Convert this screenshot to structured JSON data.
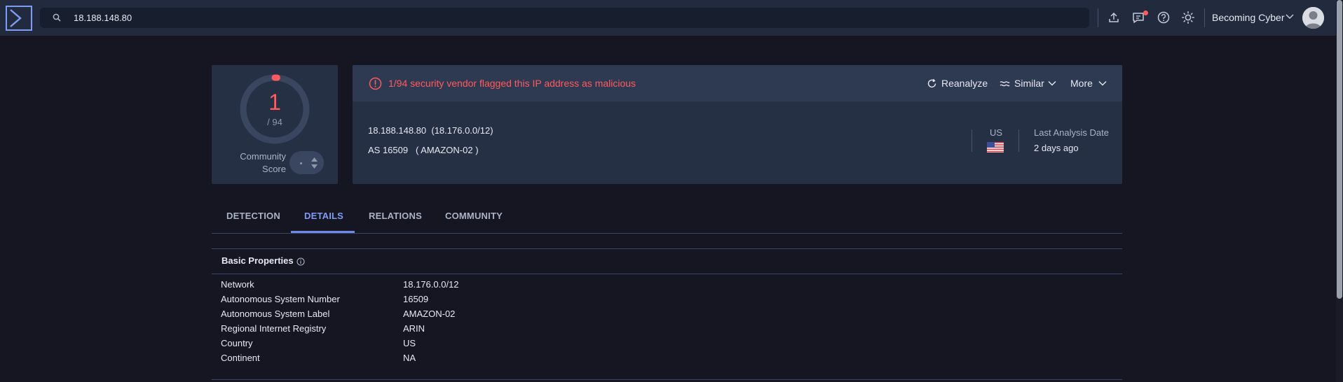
{
  "search": {
    "value": "18.188.148.80"
  },
  "header": {
    "account_name": "Becoming Cyber"
  },
  "score": {
    "value": "1",
    "total": "/ 94",
    "community_label_line1": "Community",
    "community_label_line2": "Score",
    "malicious_fraction": 0.0106
  },
  "alert": {
    "text": "1/94 security vendor flagged this IP address as malicious",
    "reanalyze": "Reanalyze",
    "similar": "Similar",
    "more": "More"
  },
  "summary": {
    "ip": "18.188.148.80",
    "network": "(18.176.0.0/12)",
    "as_number": "AS 16509",
    "as_label": "( AMAZON-02 )",
    "country": "US",
    "last_analysis_label": "Last Analysis Date",
    "last_analysis_value": "2 days ago"
  },
  "tabs": [
    {
      "label": "DETECTION",
      "active": false
    },
    {
      "label": "DETAILS",
      "active": true
    },
    {
      "label": "RELATIONS",
      "active": false
    },
    {
      "label": "COMMUNITY",
      "active": false
    }
  ],
  "basic_properties": {
    "title": "Basic Properties",
    "rows": [
      {
        "key": "Network",
        "value": "18.176.0.0/12"
      },
      {
        "key": "Autonomous System Number",
        "value": "16509"
      },
      {
        "key": "Autonomous System Label",
        "value": "AMAZON-02"
      },
      {
        "key": "Regional Internet Registry",
        "value": "ARIN"
      },
      {
        "key": "Country",
        "value": "US"
      },
      {
        "key": "Continent",
        "value": "NA"
      }
    ]
  },
  "colors": {
    "background": "#161622",
    "card": "#263045",
    "malicious": "#ff5a5f",
    "active_tab": "#7f9cf5"
  }
}
